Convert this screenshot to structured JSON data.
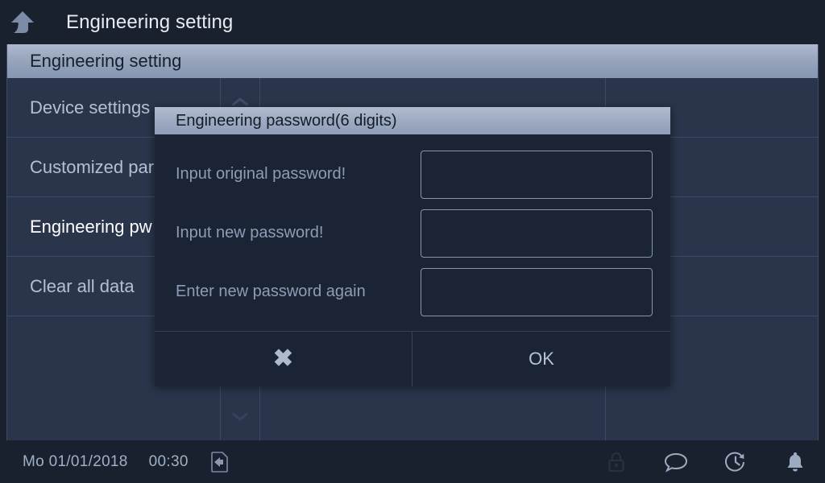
{
  "titlebar": {
    "back_icon": "back-up-arrow-icon",
    "title": "Engineering setting"
  },
  "panel": {
    "header_label": "Engineering setting",
    "items": [
      {
        "label": "Device settings",
        "selected": false
      },
      {
        "label": "Customized parameters",
        "selected": false
      },
      {
        "label": "Engineering pw",
        "selected": true
      },
      {
        "label": "Clear all data",
        "selected": false
      }
    ],
    "scroll": {
      "up_icon": "chevron-up-icon",
      "down_icon": "chevron-down-icon",
      "down_icon_2": "chevron-down-icon"
    }
  },
  "dialog": {
    "title": "Engineering password(6 digits)",
    "fields": [
      {
        "label": "Input original password!",
        "value": "",
        "placeholder": ""
      },
      {
        "label": "Input new password!",
        "value": "",
        "placeholder": ""
      },
      {
        "label": "Enter new password again",
        "value": "",
        "placeholder": ""
      }
    ],
    "cancel_label": "✖",
    "ok_label": "OK"
  },
  "statusbar": {
    "date": "Mo 01/01/2018",
    "time": "00:30",
    "card_icon": "sd-card-eject-icon",
    "icons": [
      {
        "name": "lock-icon",
        "active": false
      },
      {
        "name": "message-bubble-icon",
        "active": true
      },
      {
        "name": "history-clock-icon",
        "active": true
      },
      {
        "name": "bell-icon",
        "active": true
      }
    ]
  },
  "colors": {
    "background": "#19212f",
    "panel": "#2a354b",
    "header_gradient_top": "#aeb9cd",
    "header_gradient_bottom": "#8695b1",
    "dialog_body": "#1b2434",
    "text_primary": "#e8ecf2",
    "text_muted": "#8e9db4",
    "border": "#3c4a62"
  }
}
